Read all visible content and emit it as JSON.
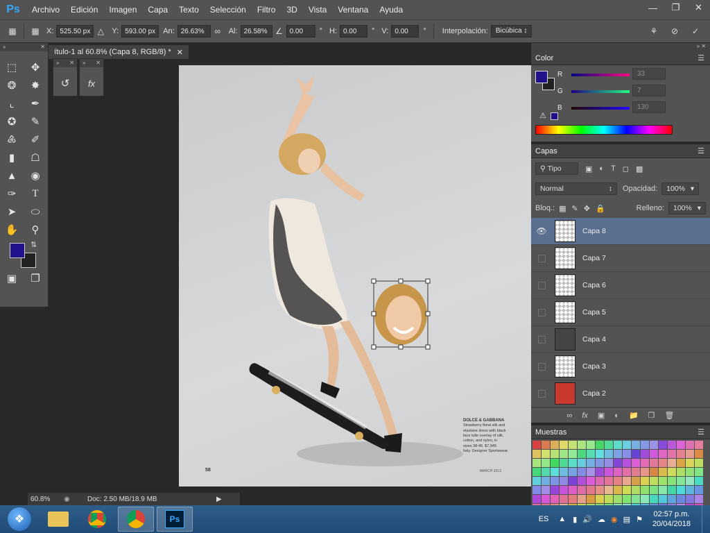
{
  "menubar": {
    "app_logo": "Ps",
    "items": [
      "Archivo",
      "Edición",
      "Imagen",
      "Capa",
      "Texto",
      "Selección",
      "Filtro",
      "3D",
      "Vista",
      "Ventana",
      "Ayuda"
    ],
    "window_controls": [
      "minimize",
      "restore",
      "close"
    ]
  },
  "options": {
    "x_label": "X:",
    "x_value": "525.50 px",
    "y_label": "Y:",
    "y_value": "593.00 px",
    "w_label": "An:",
    "w_value": "26.63%",
    "h_label": "Al:",
    "h_value": "26.58%",
    "angle_value": "0.00",
    "hskew_label": "H:",
    "hskew_value": "0.00",
    "vskew_label": "V:",
    "vskew_value": "0.00",
    "degree": "°",
    "interp_label": "Interpolación:",
    "interp_value": "Bicúbica"
  },
  "document": {
    "tab_title": "ítulo-1 al 60.8% (Capa 8, RGB/8) *",
    "page_number": "58",
    "footer_right": "MARCH 2013",
    "caption_title": "DOLCE & GABBANA",
    "caption_lines": [
      "Strawberry floral silk and",
      "elastane dress with black",
      "face tulle overlay of silk,",
      "cotton, and nylon, in",
      "sizes 38-46. $7,945",
      "Italy. Designer Sportswear."
    ]
  },
  "status": {
    "zoom": "60.8%",
    "doc_info": "Doc: 2.50 MB/18.9 MB"
  },
  "colors": {
    "foreground": "#21118a",
    "background": "#222222",
    "accent_selection": "#5a6e90",
    "ps_blue": "#31a8ff"
  },
  "color_panel": {
    "title": "Color",
    "r_label": "R",
    "r_value": "33",
    "g_label": "G",
    "g_value": "7",
    "b_label": "B",
    "b_value": "130"
  },
  "layers_panel": {
    "title": "Capas",
    "filter_label": "Tipo",
    "blend_mode": "Normal",
    "opacity_label": "Opacidad:",
    "opacity_value": "100%",
    "lock_label": "Bloq.:",
    "fill_label": "Relleno:",
    "fill_value": "100%",
    "layers": [
      {
        "name": "Capa 8",
        "visible": true,
        "selected": true
      },
      {
        "name": "Capa 7",
        "visible": false,
        "selected": false
      },
      {
        "name": "Capa 6",
        "visible": false,
        "selected": false
      },
      {
        "name": "Capa 5",
        "visible": false,
        "selected": false
      },
      {
        "name": "Capa 4",
        "visible": false,
        "selected": false
      },
      {
        "name": "Capa 3",
        "visible": false,
        "selected": false
      },
      {
        "name": "Capa 2",
        "visible": false,
        "selected": false
      }
    ]
  },
  "swatches_panel": {
    "title": "Muestras"
  },
  "taskbar": {
    "lang": "ES",
    "time": "02:57 p.m.",
    "date": "20/04/2018"
  }
}
